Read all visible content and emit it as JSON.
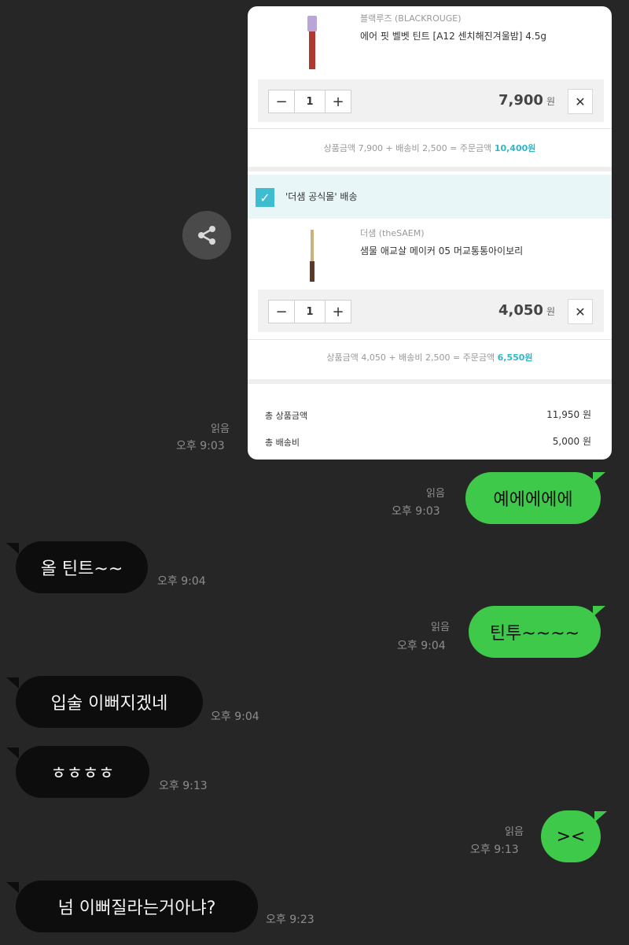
{
  "share": {
    "icon": "share-icon"
  },
  "card": {
    "item1": {
      "brand": "블랙루즈 (BLACKROUGE)",
      "name": "에어 핏 벨벳 틴트 [A12 센치해진겨울밤] 4.5g",
      "qty": "1",
      "price": "7,900",
      "unit": "원",
      "summary": {
        "label": "상품금액 7,900 + 배송비 2,500 = 주문금액",
        "amount": "10,400원"
      }
    },
    "seller2": {
      "label": "'더샘 공식몰' 배송",
      "checked": true
    },
    "item2": {
      "brand": "더샘 (theSAEM)",
      "name": "샘물 애교살 메이커 05 머교통통아이보리",
      "qty": "1",
      "price": "4,050",
      "unit": "원",
      "summary": {
        "label": "상품금액 4,050 + 배송비 2,500 = 주문금액",
        "amount": "6,550원"
      }
    },
    "totals": {
      "product_label": "총 상품금액",
      "product_value": "11,950 원",
      "shipping_label": "총 배송비",
      "shipping_value": "5,000 원"
    },
    "minus": "−",
    "plus": "+",
    "remove": "✕",
    "check": "✓"
  },
  "messages": [
    {
      "side": "out-card",
      "read": "읽음",
      "time": "오후 9:03"
    },
    {
      "side": "out",
      "text": "예에에에에",
      "read": "읽음",
      "time": "오후 9:03"
    },
    {
      "side": "in",
      "text": "올 틴트~~",
      "time": "오후 9:04"
    },
    {
      "side": "out",
      "text": "틴투~~~~",
      "read": "읽음",
      "time": "오후 9:04"
    },
    {
      "side": "in",
      "text": "입술 이뻐지겠네",
      "time": "오후 9:04"
    },
    {
      "side": "in",
      "text": "ㅎㅎㅎㅎ",
      "time": "오후 9:13"
    },
    {
      "side": "out",
      "text": "><",
      "read": "읽음",
      "time": "오후 9:13"
    },
    {
      "side": "in",
      "text": "넘 이뻐질라는거아냐?",
      "time": "오후 9:23"
    }
  ],
  "colors": {
    "background": "#262626",
    "outgoing": "#3ec94a",
    "incoming": "#0d0d0d",
    "accent": "#2fb7c8"
  }
}
